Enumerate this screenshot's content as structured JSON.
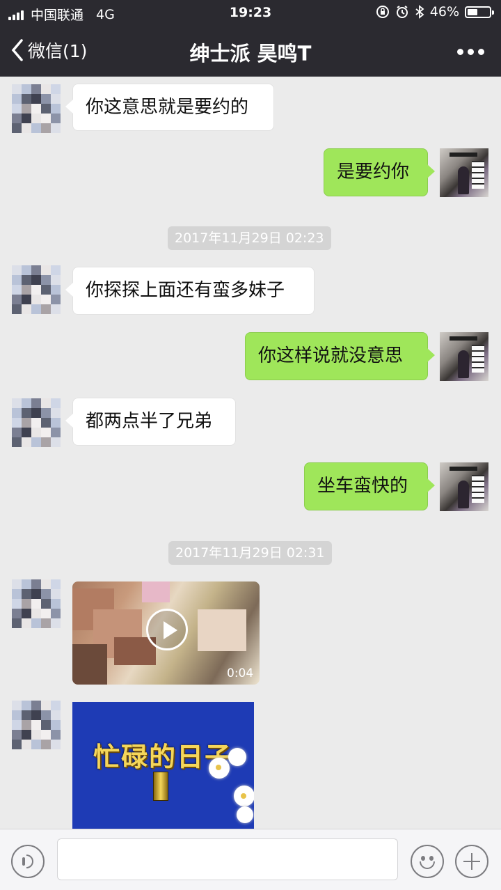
{
  "status_bar": {
    "carrier": "中国联通",
    "network": "4G",
    "time": "19:23",
    "battery_percent": "46%",
    "battery_level": 0.46
  },
  "nav": {
    "back_label": "微信(1)",
    "title": "绅士派 昊鸣T"
  },
  "messages": [
    {
      "side": "in",
      "text": "你这意思就是要约的"
    },
    {
      "side": "out",
      "text": "是要约你"
    },
    {
      "type": "timestamp",
      "text": "2017年11月29日 02:23"
    },
    {
      "side": "in",
      "text": "你探探上面还有蛮多妹子"
    },
    {
      "side": "out",
      "text": "你这样说就没意思"
    },
    {
      "side": "in",
      "text": "都两点半了兄弟"
    },
    {
      "side": "out",
      "text": "坐车蛮快的"
    },
    {
      "type": "timestamp",
      "text": "2017年11月29日 02:31"
    },
    {
      "side": "in",
      "type": "video",
      "duration": "0:04"
    },
    {
      "side": "in",
      "type": "image",
      "caption": "忙碌的日子"
    }
  ],
  "colors": {
    "header_bg": "#2b2a30",
    "chat_bg": "#ebebeb",
    "bubble_out": "#9fe65a",
    "bubble_in": "#ffffff"
  }
}
